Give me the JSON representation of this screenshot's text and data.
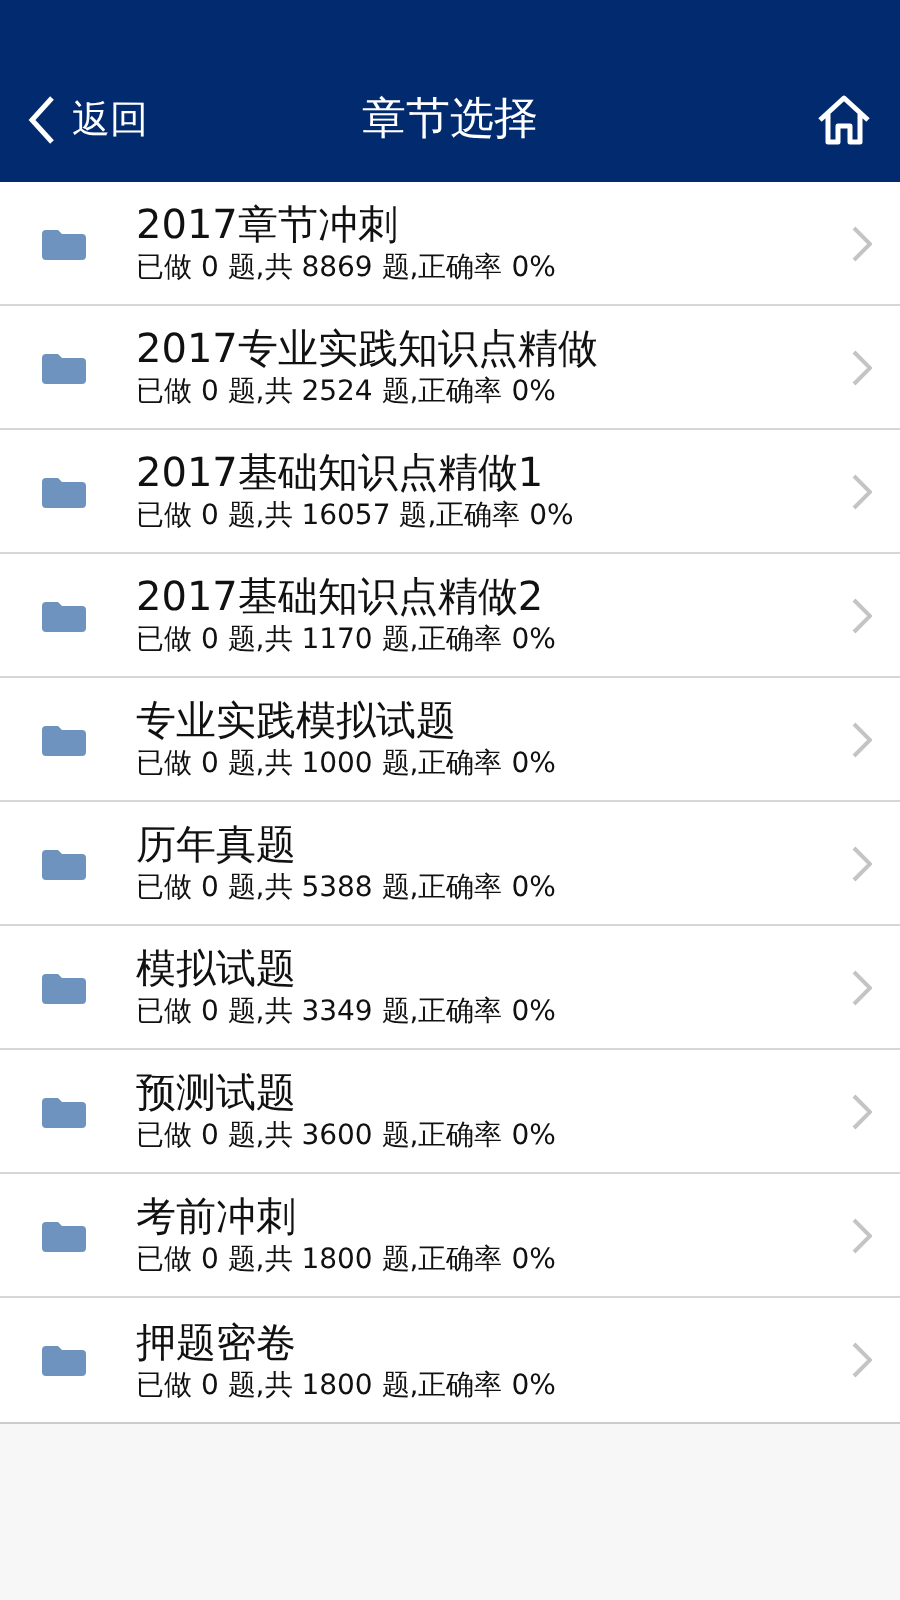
{
  "nav_bar": {
    "back_label": "返回",
    "title": "章节选择"
  },
  "chapters": [
    {
      "title": "2017章节冲刺",
      "stats": "已做 0 题,共 8869 题,正确率 0%"
    },
    {
      "title": "2017专业实践知识点精做",
      "stats": "已做 0 题,共 2524 题,正确率 0%"
    },
    {
      "title": "2017基础知识点精做1",
      "stats": "已做 0 题,共 16057 题,正确率 0%"
    },
    {
      "title": "2017基础知识点精做2",
      "stats": "已做 0 题,共 1170 题,正确率 0%"
    },
    {
      "title": "专业实践模拟试题",
      "stats": "已做 0 题,共 1000 题,正确率 0%"
    },
    {
      "title": "历年真题",
      "stats": "已做 0 题,共 5388 题,正确率 0%"
    },
    {
      "title": "模拟试题",
      "stats": "已做 0 题,共 3349 题,正确率 0%"
    },
    {
      "title": "预测试题",
      "stats": "已做 0 题,共 3600 题,正确率 0%"
    },
    {
      "title": "考前冲刺",
      "stats": "已做 0 题,共 1800 题,正确率 0%"
    },
    {
      "title": "押题密卷",
      "stats": "已做 0 题,共 1800 题,正确率 0%"
    }
  ]
}
